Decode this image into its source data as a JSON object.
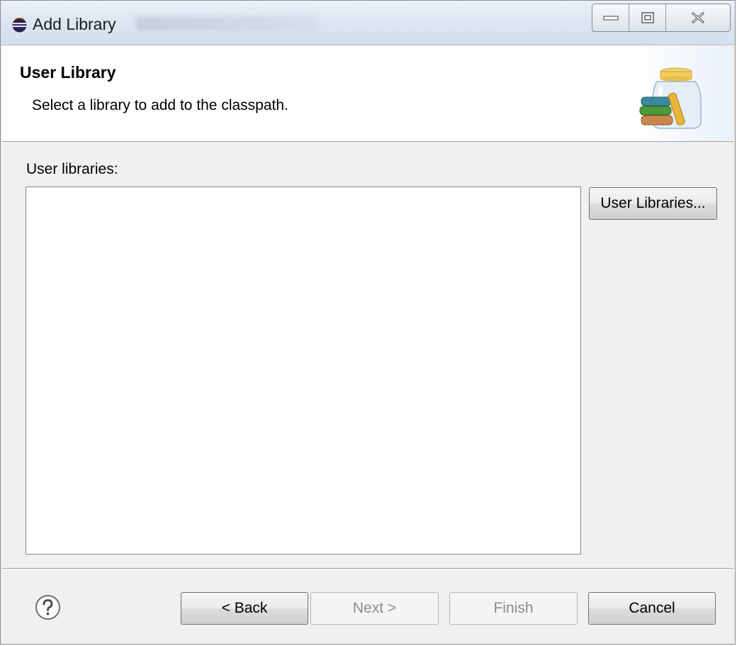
{
  "window": {
    "title": "Add Library",
    "controls": [
      "minimize",
      "maximize",
      "close"
    ]
  },
  "header": {
    "title": "User Library",
    "description": "Select a library to add to the classpath."
  },
  "body": {
    "list_label": "User libraries:",
    "list_items": [],
    "user_libraries_button": "User Libraries..."
  },
  "footer": {
    "back_label": "< Back",
    "next_label": "Next >",
    "finish_label": "Finish",
    "cancel_label": "Cancel"
  },
  "colors": {
    "titlebar": "#dde7f1",
    "dialog_background": "#f0f0f0",
    "disabled_text": "#8c8c8c"
  },
  "icons": [
    "eclipse-icon",
    "library-jar-icon",
    "help-icon",
    "minimize-icon",
    "maximize-icon",
    "close-icon"
  ]
}
